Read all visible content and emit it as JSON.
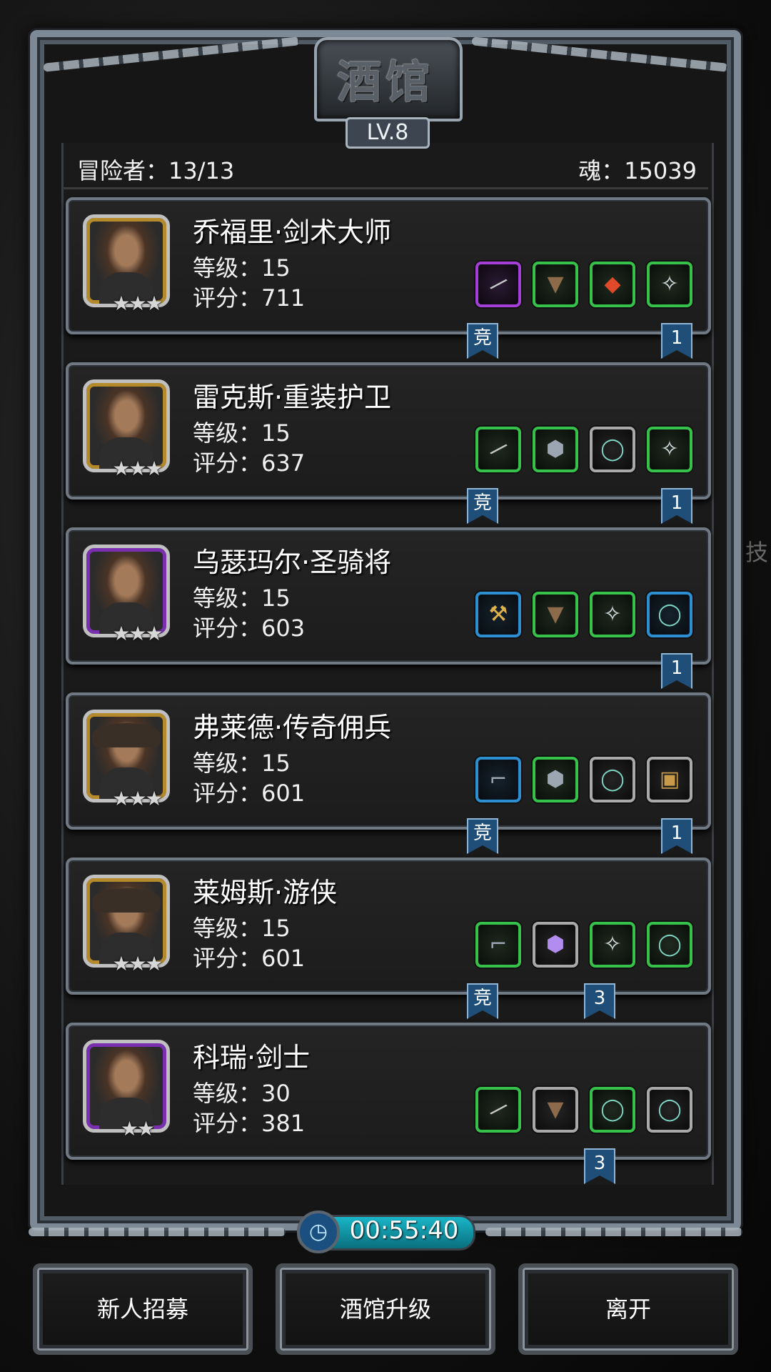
{
  "header": {
    "title": "酒馆",
    "level_badge": "LV.8",
    "adventurers_stat": "冒险者：13/13",
    "soul_stat": "魂：15039"
  },
  "background": {
    "ghost_text": "技"
  },
  "adventurers": [
    {
      "name": "乔福里·剑术大师",
      "level": "等级：15",
      "score": "评分：711",
      "frame": "gold",
      "stars": "★★★",
      "ribbon_left": "竞",
      "ribbon_right": "1",
      "equipment": [
        {
          "icon": "sword-icon",
          "glyph": "/",
          "rarity": "purple"
        },
        {
          "icon": "leather-armor-icon",
          "glyph": "▼",
          "rarity": "green"
        },
        {
          "icon": "fire-gem-icon",
          "glyph": "◆",
          "rarity": "green"
        },
        {
          "icon": "amulet-icon",
          "glyph": "✧",
          "rarity": "green"
        }
      ]
    },
    {
      "name": "雷克斯·重装护卫",
      "level": "等级：15",
      "score": "评分：637",
      "frame": "gold",
      "stars": "★★★",
      "ribbon_left": "竞",
      "ribbon_right": "1",
      "equipment": [
        {
          "icon": "sword-icon",
          "glyph": "/",
          "rarity": "green"
        },
        {
          "icon": "plate-armor-icon",
          "glyph": "⬢",
          "rarity": "green"
        },
        {
          "icon": "ring-icon",
          "glyph": "◯",
          "rarity": "gray"
        },
        {
          "icon": "amulet-icon",
          "glyph": "✧",
          "rarity": "green"
        }
      ]
    },
    {
      "name": "乌瑟玛尔·圣骑将",
      "level": "等级：15",
      "score": "评分：603",
      "frame": "purple",
      "stars": "★★★",
      "ribbon_left": "",
      "ribbon_right": "1",
      "equipment": [
        {
          "icon": "hammer-icon",
          "glyph": "⚒",
          "rarity": "blue"
        },
        {
          "icon": "leather-armor-icon",
          "glyph": "▼",
          "rarity": "green"
        },
        {
          "icon": "amulet-icon",
          "glyph": "✧",
          "rarity": "green"
        },
        {
          "icon": "ring-icon",
          "glyph": "◯",
          "rarity": "blue"
        }
      ]
    },
    {
      "name": "弗莱德·传奇佣兵",
      "level": "等级：15",
      "score": "评分：601",
      "frame": "gold",
      "stars": "★★★",
      "ribbon_left": "竞",
      "ribbon_right": "1",
      "equipment": [
        {
          "icon": "pistol-icon",
          "glyph": "⌐",
          "rarity": "blue"
        },
        {
          "icon": "plate-armor-icon",
          "glyph": "⬢",
          "rarity": "green"
        },
        {
          "icon": "ring-icon",
          "glyph": "◯",
          "rarity": "gray"
        },
        {
          "icon": "chest-armor-icon",
          "glyph": "▣",
          "rarity": "gray"
        }
      ]
    },
    {
      "name": "莱姆斯·游侠",
      "level": "等级：15",
      "score": "评分：601",
      "frame": "gold",
      "stars": "★★★",
      "ribbon_left": "竞",
      "ribbon_mid": "3",
      "equipment": [
        {
          "icon": "pistol-icon",
          "glyph": "⌐",
          "rarity": "green"
        },
        {
          "icon": "void-armor-icon",
          "glyph": "⬢",
          "rarity": "gray"
        },
        {
          "icon": "amulet-icon",
          "glyph": "✧",
          "rarity": "green"
        },
        {
          "icon": "ring-icon",
          "glyph": "◯",
          "rarity": "green"
        }
      ]
    },
    {
      "name": "科瑞·剑士",
      "level": "等级：30",
      "score": "评分：381",
      "frame": "purple",
      "stars": "★★",
      "ribbon_mid": "3",
      "equipment": [
        {
          "icon": "sword-icon",
          "glyph": "/",
          "rarity": "green"
        },
        {
          "icon": "leather-armor-icon",
          "glyph": "▼",
          "rarity": "gray"
        },
        {
          "icon": "ring-icon",
          "glyph": "◯",
          "rarity": "green"
        },
        {
          "icon": "ring-icon",
          "glyph": "◯",
          "rarity": "gray"
        }
      ]
    }
  ],
  "timer": {
    "value": "00:55:40"
  },
  "buttons": {
    "recruit": "新人招募",
    "upgrade": "酒馆升级",
    "leave": "离开"
  }
}
